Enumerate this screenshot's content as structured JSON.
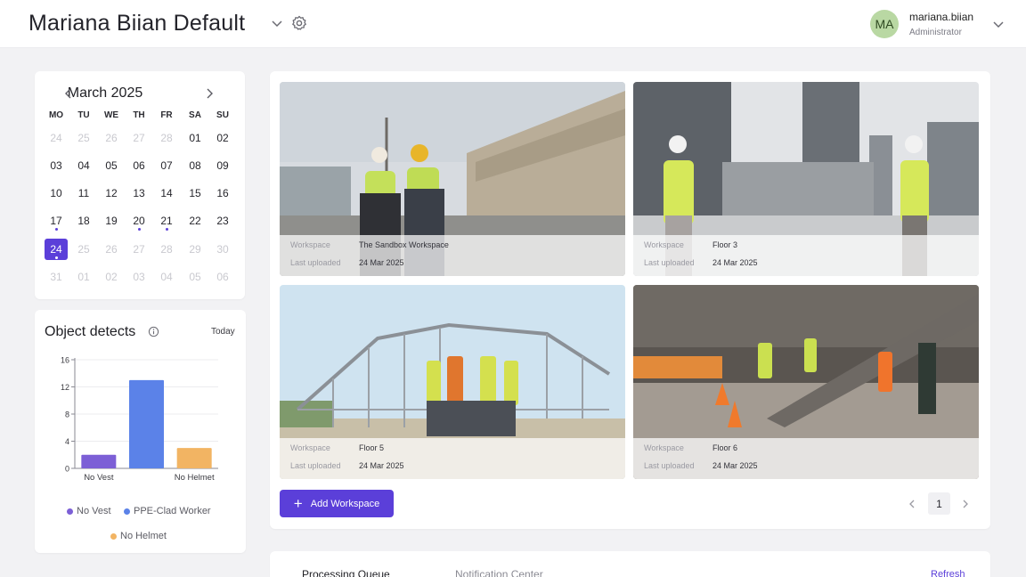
{
  "header": {
    "workspace_title": "Mariana Biian Default",
    "user": {
      "initials": "MA",
      "name": "mariana.biian",
      "role": "Administrator"
    }
  },
  "calendar": {
    "month_label": "March 2025",
    "weekdays": [
      "MO",
      "TU",
      "WE",
      "TH",
      "FR",
      "SA",
      "SU"
    ],
    "weeks": [
      [
        "24",
        "25",
        "26",
        "27",
        "28",
        "01",
        "02"
      ],
      [
        "03",
        "04",
        "05",
        "06",
        "07",
        "08",
        "09"
      ],
      [
        "10",
        "11",
        "12",
        "13",
        "14",
        "15",
        "16"
      ],
      [
        "17",
        "18",
        "19",
        "20",
        "21",
        "22",
        "23"
      ],
      [
        "24",
        "25",
        "26",
        "27",
        "28",
        "29",
        "30"
      ],
      [
        "31",
        "01",
        "02",
        "03",
        "04",
        "05",
        "06"
      ]
    ],
    "muted": [
      [
        0,
        0
      ],
      [
        0,
        1
      ],
      [
        0,
        2
      ],
      [
        0,
        3
      ],
      [
        0,
        4
      ],
      [
        4,
        1
      ],
      [
        4,
        2
      ],
      [
        4,
        3
      ],
      [
        4,
        4
      ],
      [
        4,
        5
      ],
      [
        4,
        6
      ],
      [
        5,
        0
      ],
      [
        5,
        1
      ],
      [
        5,
        2
      ],
      [
        5,
        3
      ],
      [
        5,
        4
      ],
      [
        5,
        5
      ],
      [
        5,
        6
      ]
    ],
    "selected": [
      4,
      0
    ],
    "event_dots": [
      [
        3,
        0
      ],
      [
        3,
        3
      ],
      [
        3,
        4
      ],
      [
        4,
        0
      ]
    ],
    "accent_color": "#5b3fd9"
  },
  "object_detects": {
    "title": "Object detects",
    "period": "Today",
    "legend": [
      {
        "label": "No Vest",
        "color": "#7c5fd6"
      },
      {
        "label": "PPE-Clad Worker",
        "color": "#5b82e8"
      },
      {
        "label": "No Helmet",
        "color": "#f2b463"
      }
    ]
  },
  "chart_data": {
    "type": "bar",
    "categories": [
      "No Vest",
      "PPE-Clad Worker",
      "No Helmet"
    ],
    "values": [
      2,
      13,
      3
    ],
    "x_tick_labels_shown": [
      "No Vest",
      "No Helmet"
    ],
    "colors": [
      "#7c5fd6",
      "#5b82e8",
      "#f2b463"
    ],
    "yticks": [
      0,
      4,
      8,
      12,
      16
    ],
    "ylim": [
      0,
      16
    ],
    "grid": true,
    "legend_position": "bottom"
  },
  "workspaces": {
    "label_workspace": "Workspace",
    "label_uploaded": "Last uploaded",
    "items": [
      {
        "name": "The Sandbox Workspace",
        "uploaded": "24 Mar 2025",
        "scene": "port"
      },
      {
        "name": "Floor 3",
        "uploaded": "24 Mar 2025",
        "scene": "city"
      },
      {
        "name": "Floor 5",
        "uploaded": "24 Mar 2025",
        "scene": "frame"
      },
      {
        "name": "Floor 6",
        "uploaded": "24 Mar 2025",
        "scene": "street"
      }
    ],
    "add_button": "Add Workspace",
    "current_page": "1"
  },
  "bottom_tabs": {
    "active": "Processing Queue",
    "inactive": "Notification Center",
    "refresh": "Refresh"
  }
}
